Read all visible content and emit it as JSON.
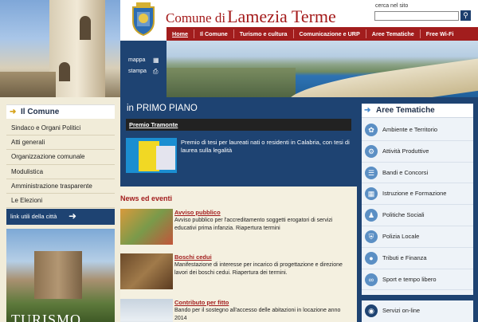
{
  "site": {
    "title_small": "Comune di",
    "title_big": "Lamezia Terme"
  },
  "search": {
    "label": "cerca nel sito",
    "placeholder": "",
    "button_icon": "search-icon"
  },
  "nav": [
    {
      "label": "Home",
      "active": true
    },
    {
      "label": "Il Comune",
      "active": false
    },
    {
      "label": "Turismo e cultura",
      "active": false
    },
    {
      "label": "Comunicazione e URP",
      "active": false
    },
    {
      "label": "Aree Tematiche",
      "active": false
    },
    {
      "label": "Free Wi-Fi",
      "active": false
    }
  ],
  "side_links": {
    "mappa": "mappa",
    "stampa": "stampa"
  },
  "left": {
    "title": "Il Comune",
    "menu": [
      "Sindaco e Organi Politici",
      "Atti generali",
      "Organizzazione comunale",
      "Modulistica",
      "Amministrazione trasparente",
      "Le Elezioni"
    ],
    "links_label": "link utili della città",
    "turismo_label": "TURISMO"
  },
  "primo_piano": {
    "title": "in PRIMO PIANO",
    "item_title": "Premio Tramonte",
    "item_text": "Premio di tesi per laureati nati o residenti in Calabria, con tesi di laurea sulla legalità"
  },
  "news": {
    "title": "News ed eventi",
    "items": [
      {
        "title": "Avviso pubblico",
        "text": "Avviso pubblico per l'accreditamento soggetti erogatori di servizi educativi prima infanzia. Riapertura termini"
      },
      {
        "title": "Boschi cedui",
        "text": "Manifestazione di interesse per incarico di progettazione e direzione lavori dei boschi cedui. Riapertura dei termini."
      },
      {
        "title": "Contributo per fitto",
        "text": "Bando per il sostegno all'accesso delle abitazioni in locazione anno 2014"
      }
    ]
  },
  "aree": {
    "title": "Aree Tematiche",
    "items": [
      {
        "label": "Ambiente e Territorio",
        "icon": "leaf-icon"
      },
      {
        "label": "Attività Produttive",
        "icon": "gears-icon"
      },
      {
        "label": "Bandi e Concorsi",
        "icon": "document-icon"
      },
      {
        "label": "Istruzione e Formazione",
        "icon": "book-icon"
      },
      {
        "label": "Politiche Sociali",
        "icon": "people-icon"
      },
      {
        "label": "Polizia Locale",
        "icon": "shield-icon"
      },
      {
        "label": "Tributi e Finanza",
        "icon": "coins-icon"
      },
      {
        "label": "Sport e tempo libero",
        "icon": "bicycle-icon"
      }
    ],
    "servizi": "Servizi on-line"
  },
  "colors": {
    "brand_red": "#a21d1d",
    "navy": "#1e4372",
    "cream": "#f1ecd9"
  }
}
